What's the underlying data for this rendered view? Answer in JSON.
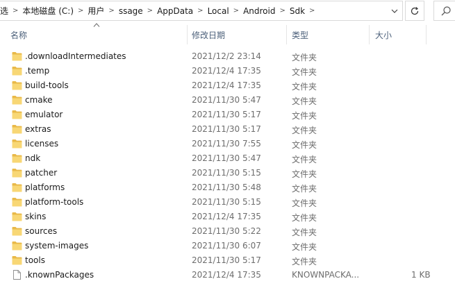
{
  "address": {
    "crumbs": [
      "选",
      "本地磁盘 (C:)",
      "用户",
      "ssage",
      "AppData",
      "Local",
      "Android",
      "Sdk"
    ]
  },
  "columns": {
    "name": "名称",
    "date": "修改日期",
    "type": "类型",
    "size": "大小"
  },
  "files": [
    {
      "name": ".downloadIntermediates",
      "date": "2021/12/2 23:14",
      "type": "文件夹",
      "size": "",
      "icon": "folder-icon"
    },
    {
      "name": ".temp",
      "date": "2021/12/4 17:35",
      "type": "文件夹",
      "size": "",
      "icon": "folder-icon"
    },
    {
      "name": "build-tools",
      "date": "2021/12/4 17:35",
      "type": "文件夹",
      "size": "",
      "icon": "folder-icon"
    },
    {
      "name": "cmake",
      "date": "2021/11/30 5:47",
      "type": "文件夹",
      "size": "",
      "icon": "folder-icon"
    },
    {
      "name": "emulator",
      "date": "2021/11/30 5:17",
      "type": "文件夹",
      "size": "",
      "icon": "folder-icon"
    },
    {
      "name": "extras",
      "date": "2021/11/30 5:17",
      "type": "文件夹",
      "size": "",
      "icon": "folder-icon"
    },
    {
      "name": "licenses",
      "date": "2021/11/30 7:55",
      "type": "文件夹",
      "size": "",
      "icon": "folder-icon"
    },
    {
      "name": "ndk",
      "date": "2021/11/30 5:47",
      "type": "文件夹",
      "size": "",
      "icon": "folder-icon"
    },
    {
      "name": "patcher",
      "date": "2021/11/30 5:15",
      "type": "文件夹",
      "size": "",
      "icon": "folder-icon"
    },
    {
      "name": "platforms",
      "date": "2021/11/30 5:48",
      "type": "文件夹",
      "size": "",
      "icon": "folder-icon"
    },
    {
      "name": "platform-tools",
      "date": "2021/11/30 5:15",
      "type": "文件夹",
      "size": "",
      "icon": "folder-icon"
    },
    {
      "name": "skins",
      "date": "2021/12/4 17:35",
      "type": "文件夹",
      "size": "",
      "icon": "folder-icon"
    },
    {
      "name": "sources",
      "date": "2021/11/30 5:22",
      "type": "文件夹",
      "size": "",
      "icon": "folder-icon"
    },
    {
      "name": "system-images",
      "date": "2021/11/30 6:07",
      "type": "文件夹",
      "size": "",
      "icon": "folder-icon"
    },
    {
      "name": "tools",
      "date": "2021/11/30 5:17",
      "type": "文件夹",
      "size": "",
      "icon": "folder-icon"
    },
    {
      "name": ".knownPackages",
      "date": "2021/12/4 17:35",
      "type": "KNOWNPACKA...",
      "size": "1 KB",
      "icon": "file-icon"
    }
  ],
  "colors": {
    "folder": "#f8d775",
    "folder_dark": "#e9b949",
    "header_text": "#4c607a",
    "meta_text": "#6d6d6d"
  }
}
